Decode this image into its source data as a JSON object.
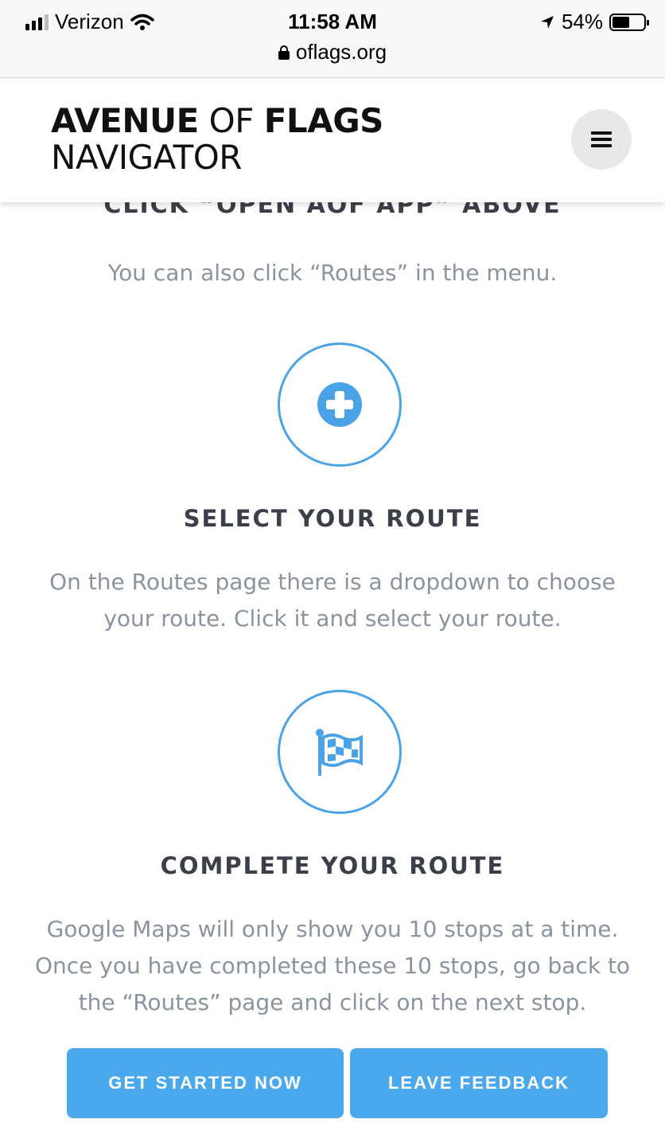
{
  "status_bar": {
    "carrier": "Verizon",
    "time": "11:58 AM",
    "battery": "54%",
    "battery_level": 0.54,
    "url": "oflags.org"
  },
  "header": {
    "brand_avenue": "AVENUE",
    "brand_of": "OF",
    "brand_flags": "FLAGS",
    "brand_navigator": "NAVIGATOR"
  },
  "steps": {
    "partial_heading": "CLICK “OPEN AOF APP” ABOVE",
    "partial_text": "You can also click “Routes” in the menu.",
    "select_title": "SELECT YOUR ROUTE",
    "select_text_1": "On the Routes page there is a dropdown to choose",
    "select_text_2": "your route. Click it and select your route.",
    "complete_title": "COMPLETE YOUR ROUTE",
    "complete_text_1": "Google Maps will only show you 10 stops at a time.",
    "complete_text_2": "Once you have completed these 10 stops, go back to",
    "complete_text_3": "the “Routes” page and click on the next stop."
  },
  "buttons": {
    "get_started": "GET STARTED NOW",
    "leave_feedback": "LEAVE FEEDBACK"
  },
  "colors": {
    "accent": "#4aa8ec",
    "icon_blue": "#4aa3e6",
    "heading": "#3b3f4a",
    "body_text": "#8a93a0"
  }
}
